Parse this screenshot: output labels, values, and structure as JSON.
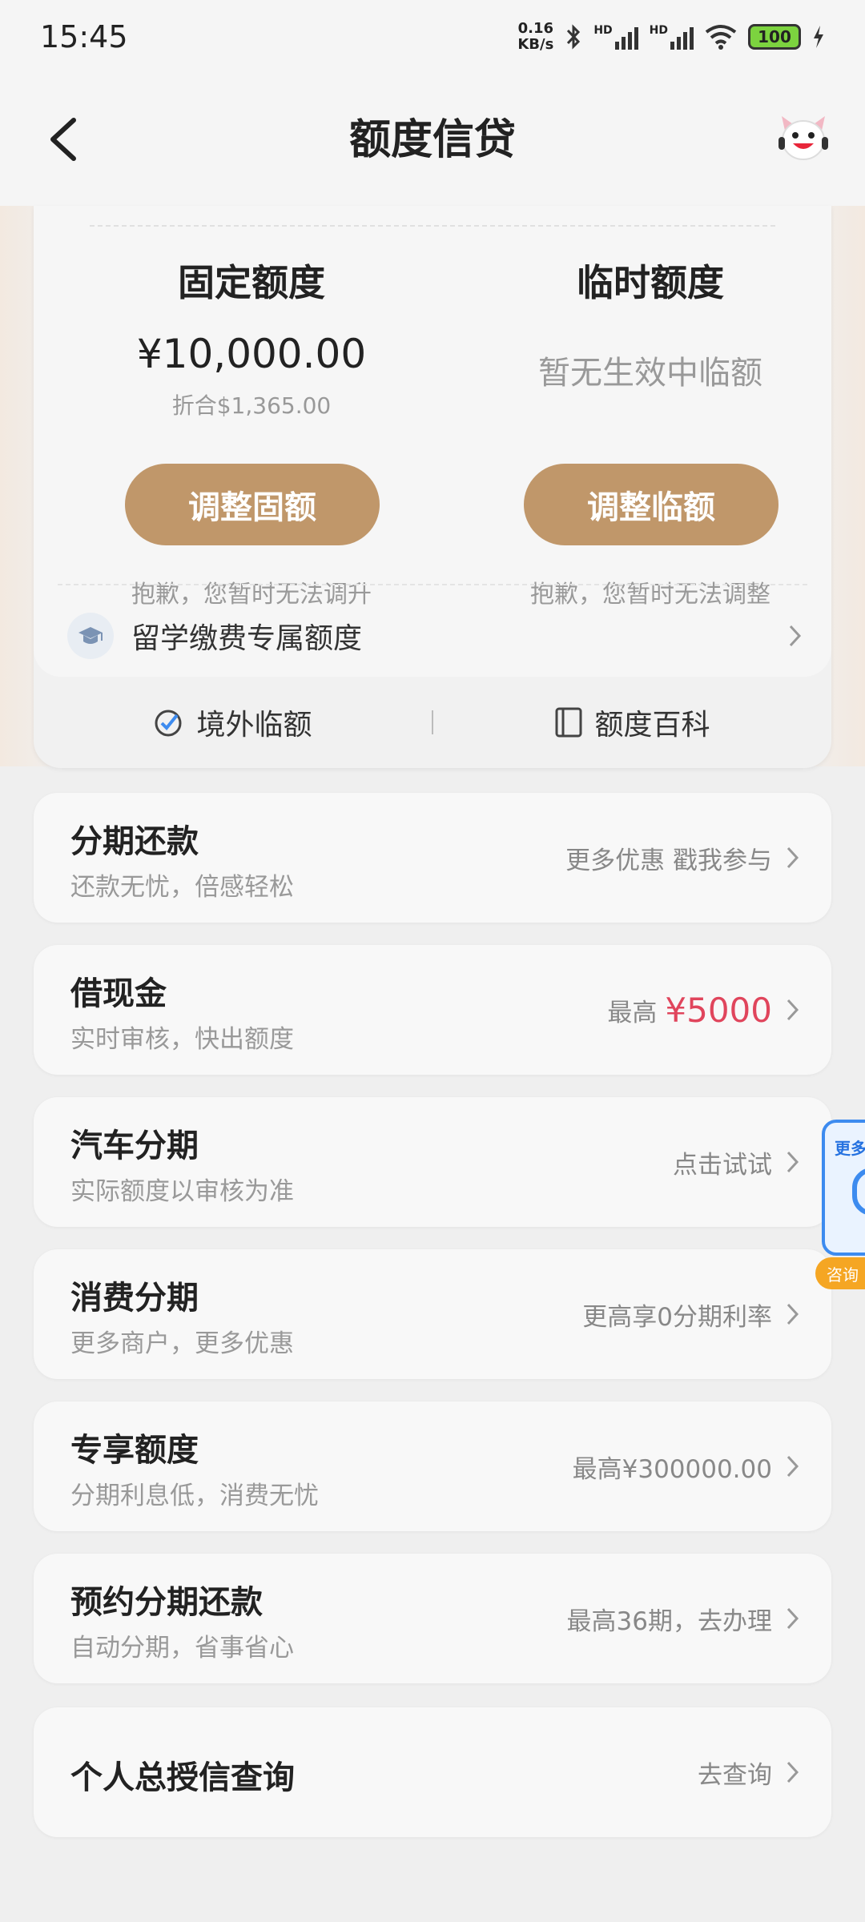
{
  "status_bar": {
    "time": "15:45",
    "net_speed_value": "0.16",
    "net_speed_unit": "KB/s",
    "signal_1_label": "HD",
    "signal_2_label": "HD",
    "battery": "100"
  },
  "header": {
    "title": "额度信贷"
  },
  "quota": {
    "fixed": {
      "title": "固定额度",
      "amount": "¥10,000.00",
      "converted": "折合$1,365.00",
      "button": "调整固额",
      "note": "抱歉，您暂时无法调升"
    },
    "temporary": {
      "title": "临时额度",
      "status": "暂无生效中临额",
      "button": "调整临额",
      "note": "抱歉，您暂时无法调整"
    },
    "study_abroad": "留学缴费专属额度",
    "links": {
      "overseas": "境外临额",
      "encyclopedia": "额度百科"
    }
  },
  "services": [
    {
      "title": "分期还款",
      "subtitle": "还款无忧，倍感轻松",
      "right": "更多优惠 戳我参与"
    },
    {
      "title": "借现金",
      "subtitle": "实时审核，快出额度",
      "right_prefix": "最高",
      "right_highlight": "¥5000"
    },
    {
      "title": "汽车分期",
      "subtitle": "实际额度以审核为准",
      "right": "点击试试"
    },
    {
      "title": "消费分期",
      "subtitle": "更多商户，更多优惠",
      "right": "更高享0分期利率"
    },
    {
      "title": "专享额度",
      "subtitle": "分期利息低，消费无忧",
      "right": "最高¥300000.00"
    },
    {
      "title": "预约分期还款",
      "subtitle": "自动分期，省事省心",
      "right": "最高36期，去办理"
    },
    {
      "title": "个人总授信查询",
      "right": "去查询"
    }
  ],
  "floating_widget": {
    "top_text": "更多",
    "tag": "咨询"
  },
  "colors": {
    "accent_button": "#c0976a",
    "highlight_red": "#e0455c",
    "widget_blue": "#3d8bef",
    "widget_orange": "#f5a623"
  }
}
